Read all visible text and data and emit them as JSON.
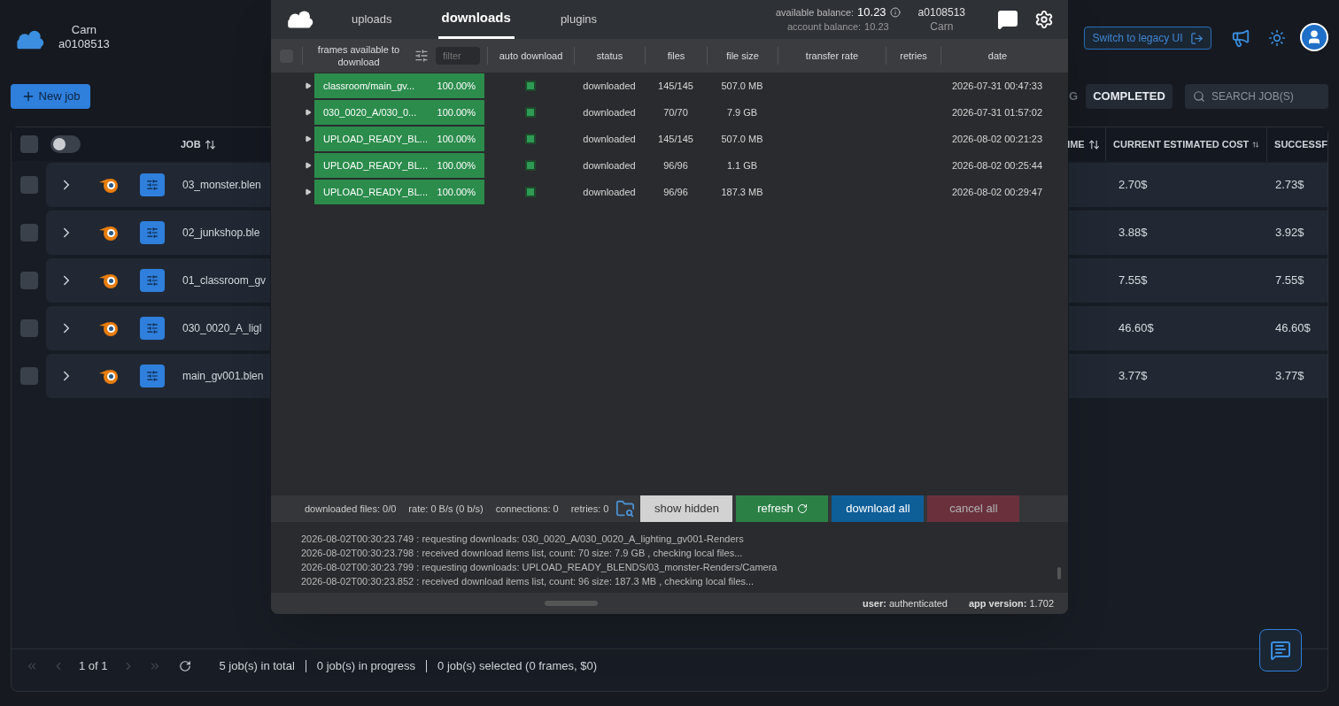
{
  "account": {
    "name": "Carn",
    "id": "a0108513"
  },
  "new_job_button": "New job",
  "legacy_button": "Switch to legacy UI",
  "status_tabs": [
    {
      "label": "G",
      "selected": false
    },
    {
      "label": "COMPLETED",
      "selected": true
    }
  ],
  "search": {
    "placeholder": "SEARCH JOB(S)"
  },
  "jobs_table": {
    "select_all": {
      "checked": false
    },
    "select_all_toggle": {
      "on": false
    },
    "columns": [
      {
        "label": "JOB",
        "sortable": true
      },
      {
        "label": "IME",
        "sortable": true
      },
      {
        "label": "CURRENT ESTIMATED COST",
        "sortable": true
      },
      {
        "label": "SUCCESSF",
        "sortable": false
      }
    ],
    "rows": [
      {
        "job": "03_monster.blen",
        "cost": "2.70$",
        "column_4": "2.73$",
        "checked": false
      },
      {
        "job": "02_junkshop.ble",
        "cost": "3.88$",
        "column_4": "3.92$",
        "checked": false
      },
      {
        "job": "01_classroom_gv",
        "cost": "7.55$",
        "column_4": "7.55$",
        "checked": false
      },
      {
        "job": "030_0020_A_ligl",
        "cost": "46.60$",
        "column_4": "46.60$",
        "checked": false
      },
      {
        "job": "main_gv001.blen",
        "cost": "3.77$",
        "column_4": "3.77$",
        "checked": false
      }
    ]
  },
  "pager": {
    "page": "1 of 1",
    "stats": [
      "5 job(s) in total",
      "0 job(s) in progress",
      "0 job(s) selected (0 frames, $0)"
    ]
  },
  "downloader": {
    "tabs": [
      {
        "label": "uploads",
        "selected": false
      },
      {
        "label": "downloads",
        "selected": true
      },
      {
        "label": "plugins",
        "selected": false
      }
    ],
    "available_balance_label": "available balance:",
    "available_balance": "10.23",
    "account_balance_label": "account balance:",
    "account_balance": "10.23",
    "account": {
      "id": "a0108513",
      "name": "Carn"
    },
    "columns": [
      "frames available to download",
      "auto download",
      "status",
      "files",
      "file size",
      "transfer rate",
      "retries",
      "date"
    ],
    "filter": {
      "placeholder": "filter"
    },
    "select_all": {
      "checked": false
    },
    "rows": [
      {
        "name": "classroom/main_gv...",
        "percent": "100.00%",
        "level": 1,
        "auto_download": true,
        "status": "downloaded",
        "files": "145/145",
        "size": "507.0 MB",
        "date": "2026-07-31 00:47:33"
      },
      {
        "name": "030_0020_A/030_0...",
        "percent": "100.00%",
        "level": 1,
        "auto_download": true,
        "status": "downloaded",
        "files": "70/70",
        "size": "7.9 GB",
        "date": "2026-07-31 01:57:02"
      },
      {
        "name": "UPLOAD_READY_BL...",
        "percent": "100.00%",
        "level": 1,
        "auto_download": true,
        "status": "downloaded",
        "files": "145/145",
        "size": "507.0 MB",
        "date": "2026-08-02 00:21:23"
      },
      {
        "name": "UPLOAD_READY_BL...",
        "percent": "100.00%",
        "level": 1,
        "auto_download": true,
        "status": "downloaded",
        "files": "96/96",
        "size": "1.1 GB",
        "date": "2026-08-02 00:25:44"
      },
      {
        "name": "UPLOAD_READY_BL...",
        "percent": "100.00%",
        "level": 1,
        "auto_download": true,
        "status": "downloaded",
        "files": "96/96",
        "size": "187.3 MB",
        "date": "2026-08-02 00:29:47"
      }
    ],
    "stats": [
      "downloaded files: 0/0",
      "rate: 0 B/s (0 b/s)",
      "connections: 0",
      "retries: 0"
    ],
    "buttons": [
      {
        "label": "show hidden",
        "kind": "light",
        "disabled": false
      },
      {
        "label": "refresh",
        "kind": "refresh",
        "disabled": false
      },
      {
        "label": "download all",
        "kind": "primary",
        "disabled": false
      },
      {
        "label": "cancel all",
        "kind": "danger",
        "disabled": true
      }
    ],
    "log": [
      "2026-08-02T00:30:23.749 : requesting downloads: 030_0020_A/030_0020_A_lighting_gv001-Renders",
      "2026-08-02T00:30:23.798 : received download items list, count: 70 size: 7.9 GB , checking local files...",
      "2026-08-02T00:30:23.799 : requesting downloads: UPLOAD_READY_BLENDS/03_monster-Renders/Camera",
      "2026-08-02T00:30:23.852 : received download items list, count: 96 size: 187.3 MB , checking local files..."
    ],
    "status": [
      {
        "label": "user:",
        "value": "authenticated"
      },
      {
        "label": "app version:",
        "value": "1.702"
      }
    ]
  }
}
